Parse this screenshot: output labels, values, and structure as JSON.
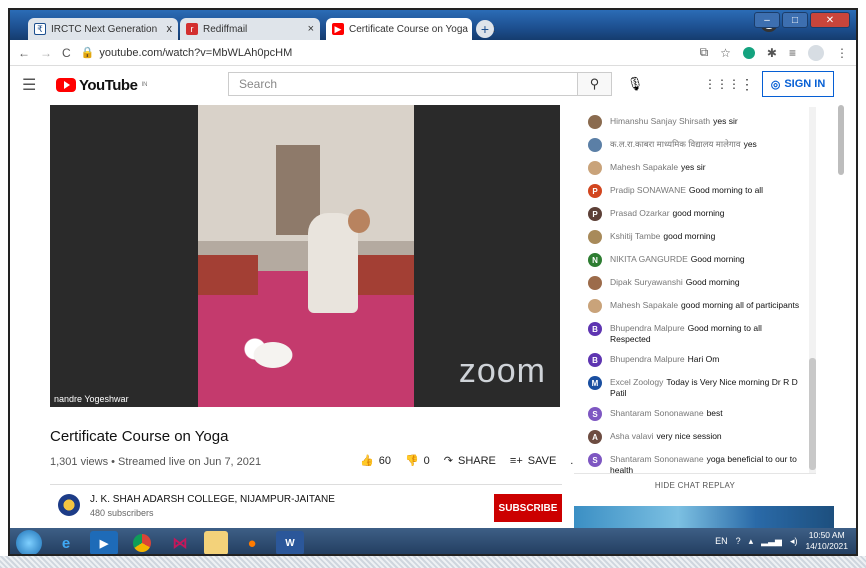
{
  "browser": {
    "tabs": [
      {
        "label": "IRCTC Next Generation eTicketin",
        "close": "x"
      },
      {
        "label": "Rediffmail",
        "close": ""
      },
      {
        "label": "Certificate Course on Yoga",
        "close": "x",
        "active": true
      }
    ],
    "new_tab": "+",
    "url": "youtube.com/watch?v=MbWLAh0pcHM"
  },
  "youtube": {
    "logo_text": "YouTube",
    "region": "IN",
    "search_placeholder": "Search",
    "sign_in": "SIGN IN"
  },
  "video": {
    "watermark": "zoom",
    "participant_name": "nandre Yogeshwar",
    "title": "Certificate Course on Yoga",
    "meta": "1,301 views • Streamed live on Jun 7, 2021",
    "likes": "60",
    "dislikes": "0",
    "share": "SHARE",
    "save": "SAVE",
    "more": "..."
  },
  "channel": {
    "name": "J. K. SHAH ADARSH COLLEGE, NIJAMPUR-JAITANE",
    "subscribers": "480 subscribers",
    "subscribe": "SUBSCRIBE"
  },
  "chat": {
    "messages": [
      {
        "author": "Himanshu Sanjay Shirsath",
        "text": "yes sir",
        "avatar": "",
        "color": "#8a6b4f"
      },
      {
        "author": "क.ल.रा.काबरा माध्यमिक विद्यालय मालेगाव",
        "text": "yes",
        "avatar": "",
        "color": "#5b7fa6"
      },
      {
        "author": "Mahesh Sapakale",
        "text": "yes sir",
        "avatar": "",
        "color": "#c9a37a"
      },
      {
        "author": "Pradip SONAWANE",
        "text": "Good morning to all",
        "avatar": "P",
        "color": "#d2461f"
      },
      {
        "author": "Prasad Ozarkar",
        "text": "good morning",
        "avatar": "P",
        "color": "#5d4037"
      },
      {
        "author": "Kshitij Tambe",
        "text": "good morning",
        "avatar": "",
        "color": "#a88a5a"
      },
      {
        "author": "NIKITA GANGURDE",
        "text": "Good morning",
        "avatar": "N",
        "color": "#2e7d32"
      },
      {
        "author": "Dipak Suryawanshi",
        "text": "Good morning",
        "avatar": "",
        "color": "#9c6b4a"
      },
      {
        "author": "Mahesh Sapakale",
        "text": "good morning all of participants",
        "avatar": "",
        "color": "#c9a37a"
      },
      {
        "author": "Bhupendra Malpure",
        "text": "Good morning to all Respected",
        "avatar": "B",
        "color": "#5e35b1"
      },
      {
        "author": "Bhupendra Malpure",
        "text": "Hari Om",
        "avatar": "B",
        "color": "#5e35b1"
      },
      {
        "author": "Excel Zoology",
        "text": "Today is Very Nice morning Dr R D Patil",
        "avatar": "M",
        "color": "#1a4fa0"
      },
      {
        "author": "Shantaram Sononawane",
        "text": "best",
        "avatar": "S",
        "color": "#7e57c2"
      },
      {
        "author": "Asha valavi",
        "text": "very nice session",
        "avatar": "A",
        "color": "#6d4c41"
      },
      {
        "author": "Shantaram Sononawane",
        "text": "yoga beneficial to our to health",
        "avatar": "S",
        "color": "#7e57c2"
      }
    ],
    "hide_replay": "HIDE CHAT REPLAY"
  },
  "taskbar": {
    "language": "EN",
    "time": "10:50 AM",
    "date": "14/10/2021"
  }
}
